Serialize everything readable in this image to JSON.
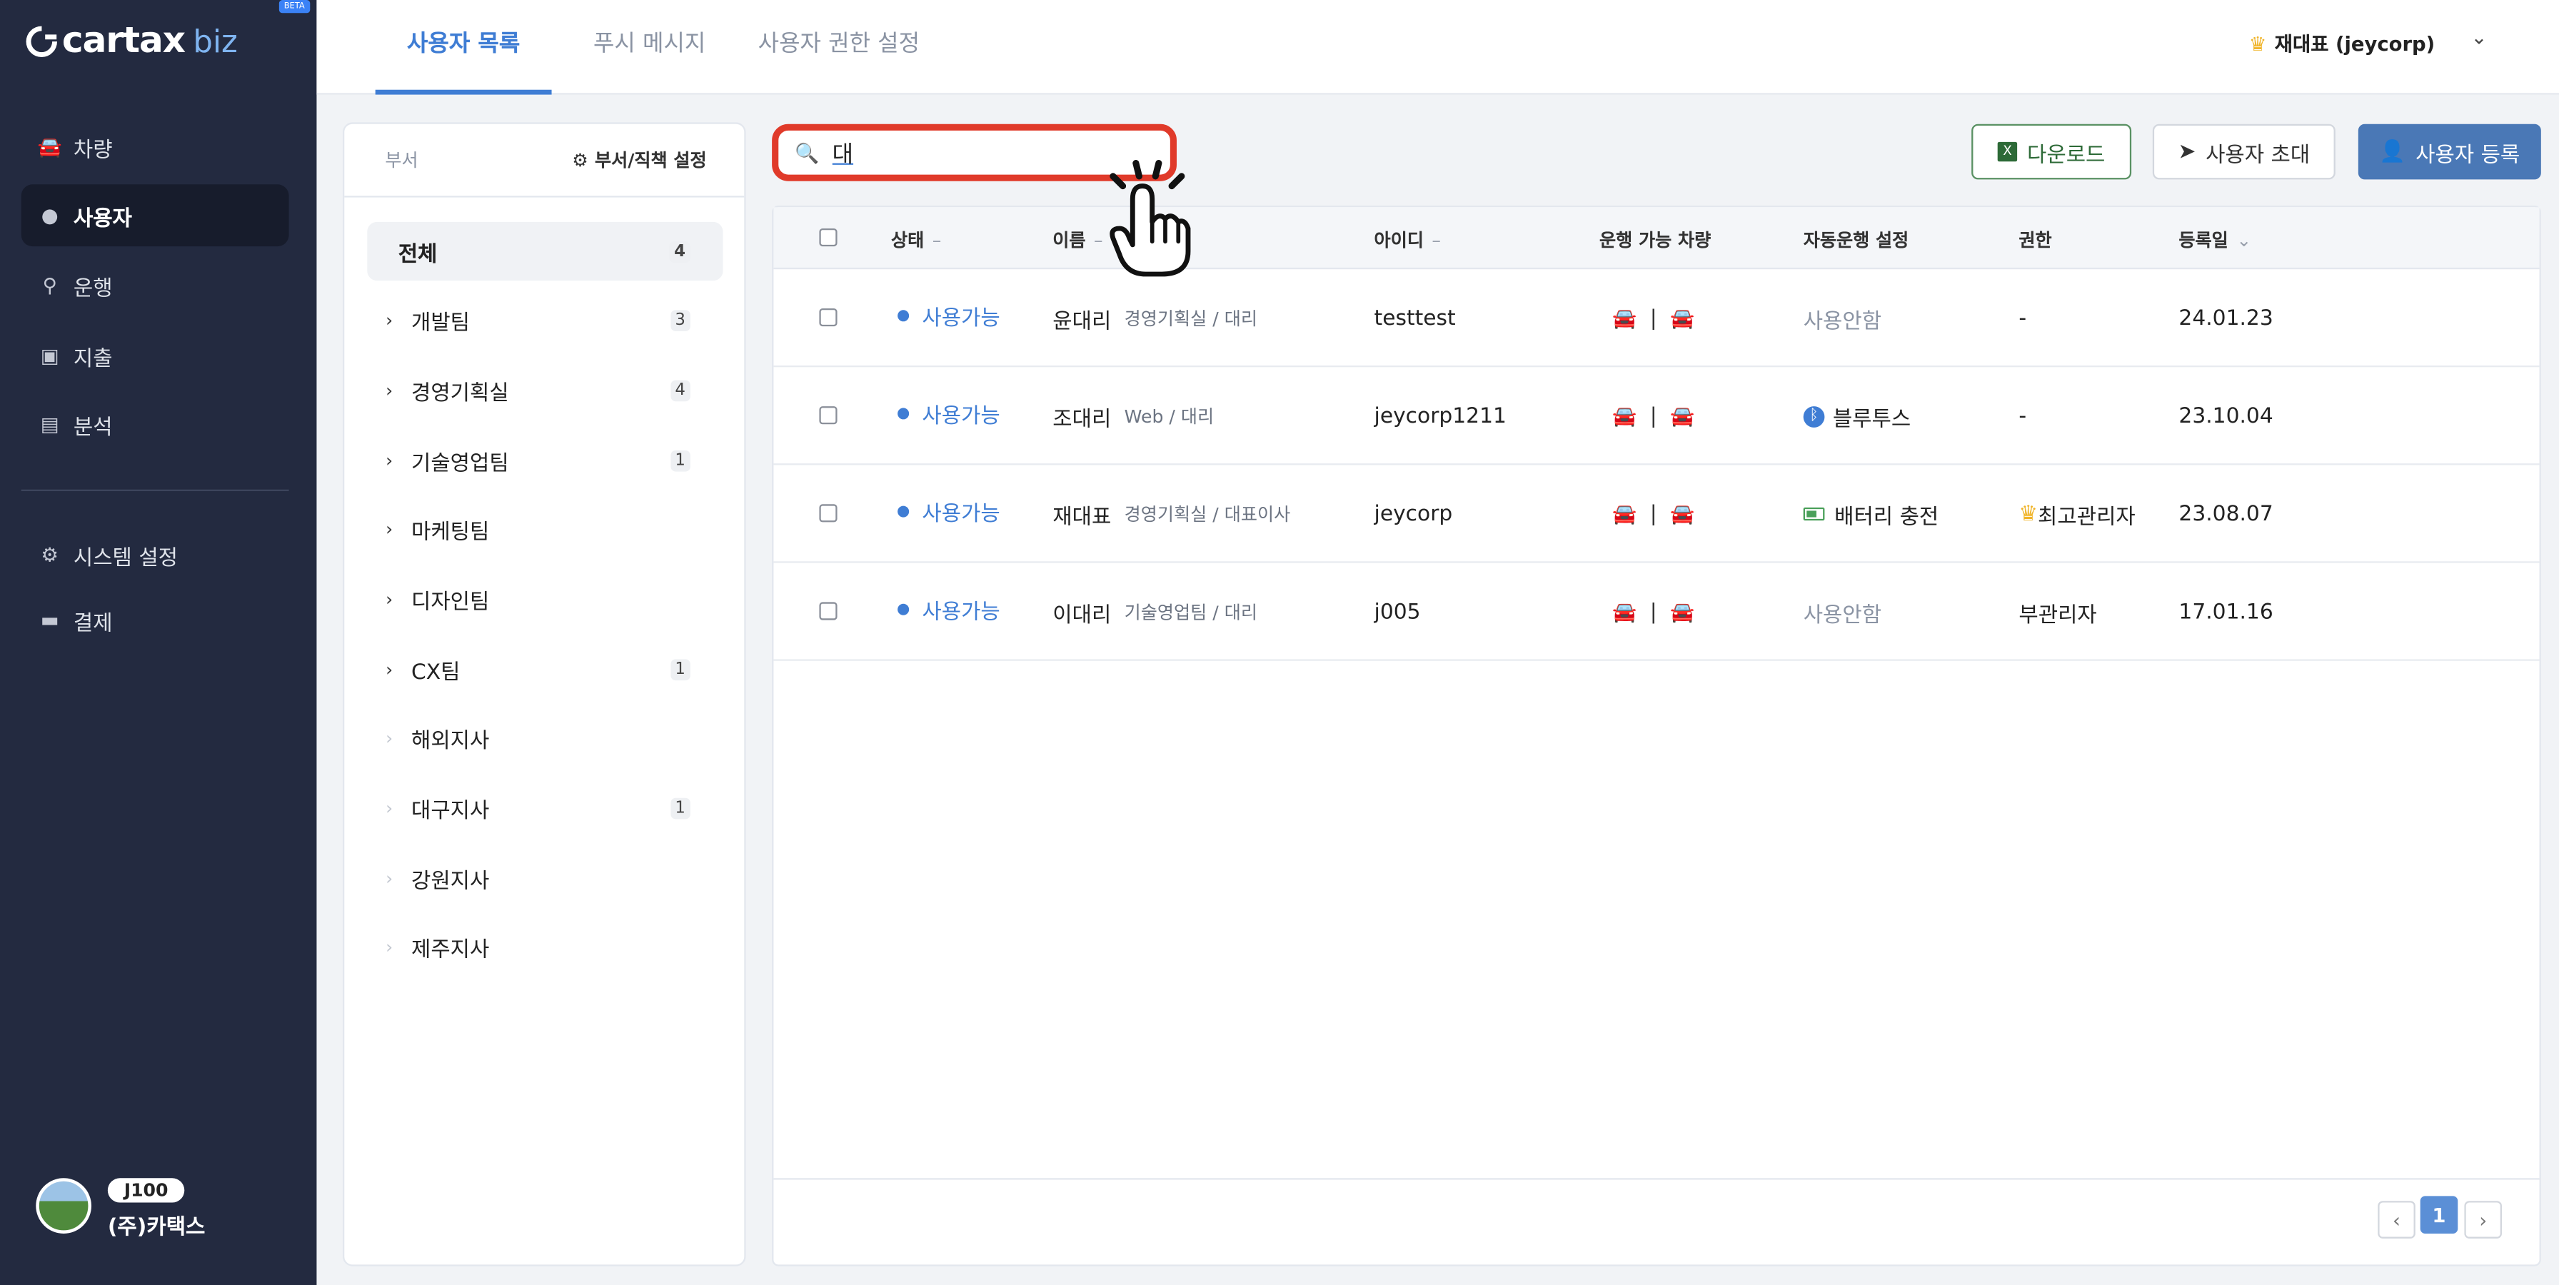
{
  "brand": {
    "logo_text": "cartax",
    "logo_sub": "biz",
    "badge": "BETA"
  },
  "sidebar": {
    "items": [
      {
        "label": "차량",
        "icon": "car-icon"
      },
      {
        "label": "사용자",
        "icon": "user-icon",
        "active": true
      },
      {
        "label": "운행",
        "icon": "location-pin-icon"
      },
      {
        "label": "지출",
        "icon": "receipt-icon"
      },
      {
        "label": "분석",
        "icon": "bar-chart-icon"
      }
    ],
    "bottom_items": [
      {
        "label": "시스템 설정",
        "icon": "gear-icon"
      },
      {
        "label": "결제",
        "icon": "credit-card-icon"
      }
    ],
    "user": {
      "plan_badge": "J100",
      "company": "(주)카택스"
    }
  },
  "header": {
    "tabs": [
      {
        "label": "사용자 목록",
        "active": true
      },
      {
        "label": "푸시 메시지"
      },
      {
        "label": "사용자 권한 설정"
      }
    ],
    "account": "재대표 (jeycorp)"
  },
  "dept_panel": {
    "title": "부서",
    "setting_label": "부서/직책 설정",
    "items": [
      {
        "label": "전체",
        "count": "4"
      },
      {
        "label": "개발팀",
        "count": "3"
      },
      {
        "label": "경영기획실",
        "count": "4"
      },
      {
        "label": "기술영업팀",
        "count": "1"
      },
      {
        "label": "마케팅팀",
        "count": ""
      },
      {
        "label": "디자인팀",
        "count": ""
      },
      {
        "label": "CX팀",
        "count": "1"
      },
      {
        "label": "해외지사",
        "count": ""
      },
      {
        "label": "대구지사",
        "count": "1"
      },
      {
        "label": "강원지사",
        "count": ""
      },
      {
        "label": "제주지사",
        "count": ""
      }
    ]
  },
  "search": {
    "value": "대",
    "placeholder": ""
  },
  "toolbar": {
    "download_label": "다운로드",
    "invite_label": "사용자 초대",
    "register_label": "사용자 등록"
  },
  "table": {
    "headers": {
      "status": "상태",
      "name": "이름",
      "id": "아이디",
      "vehicles": "운행 가능 차량",
      "auto": "자동운행 설정",
      "role": "권한",
      "date": "등록일"
    },
    "rows": [
      {
        "status": "사용가능",
        "name": "윤대리",
        "dept": "경영기획실 / 대리",
        "id": "testtest",
        "auto": "사용안함",
        "role": "-",
        "date": "24.01.23"
      },
      {
        "status": "사용가능",
        "name": "조대리",
        "dept": "Web / 대리",
        "id": "jeycorp1211",
        "auto": "블루투스",
        "role": "-",
        "date": "23.10.04"
      },
      {
        "status": "사용가능",
        "name": "재대표",
        "dept": "경영기획실 / 대표이사",
        "id": "jeycorp",
        "auto": "배터리 충전",
        "role": "최고관리자",
        "date": "23.08.07"
      },
      {
        "status": "사용가능",
        "name": "이대리",
        "dept": "기술영업팀 / 대리",
        "id": "j005",
        "auto": "사용안함",
        "role": "부관리자",
        "date": "17.01.16"
      }
    ],
    "pagination": {
      "prev": "‹",
      "current": "1",
      "next": "›"
    }
  },
  "colors": {
    "sidebar": "#232a40",
    "accent": "#3f7dd4",
    "highlight": "#e03a2a",
    "excel": "#2d6a37"
  }
}
